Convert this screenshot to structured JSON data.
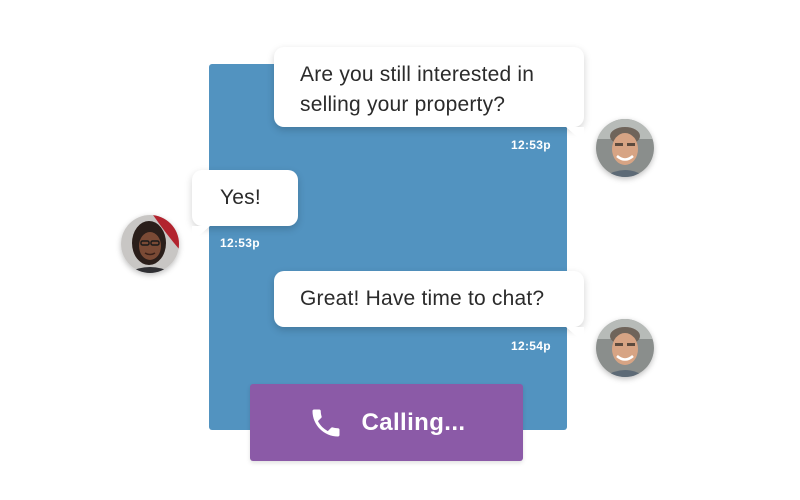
{
  "messages": [
    {
      "sender": "agent",
      "text_line1": "Are you still interested in",
      "text_line2": "selling your property?",
      "time": "12:53p"
    },
    {
      "sender": "client",
      "text": "Yes!",
      "time": "12:53p"
    },
    {
      "sender": "agent",
      "text": "Great! Have time to chat?",
      "time": "12:54p"
    }
  ],
  "call_button": {
    "label": "Calling...",
    "icon": "phone-icon"
  },
  "colors": {
    "panel": "#5293c0",
    "call_button": "#8b5aa7",
    "bubble": "#ffffff",
    "timestamp": "#ffffff"
  },
  "avatars": {
    "agent_icon": "agent-avatar",
    "client_icon": "client-avatar"
  }
}
